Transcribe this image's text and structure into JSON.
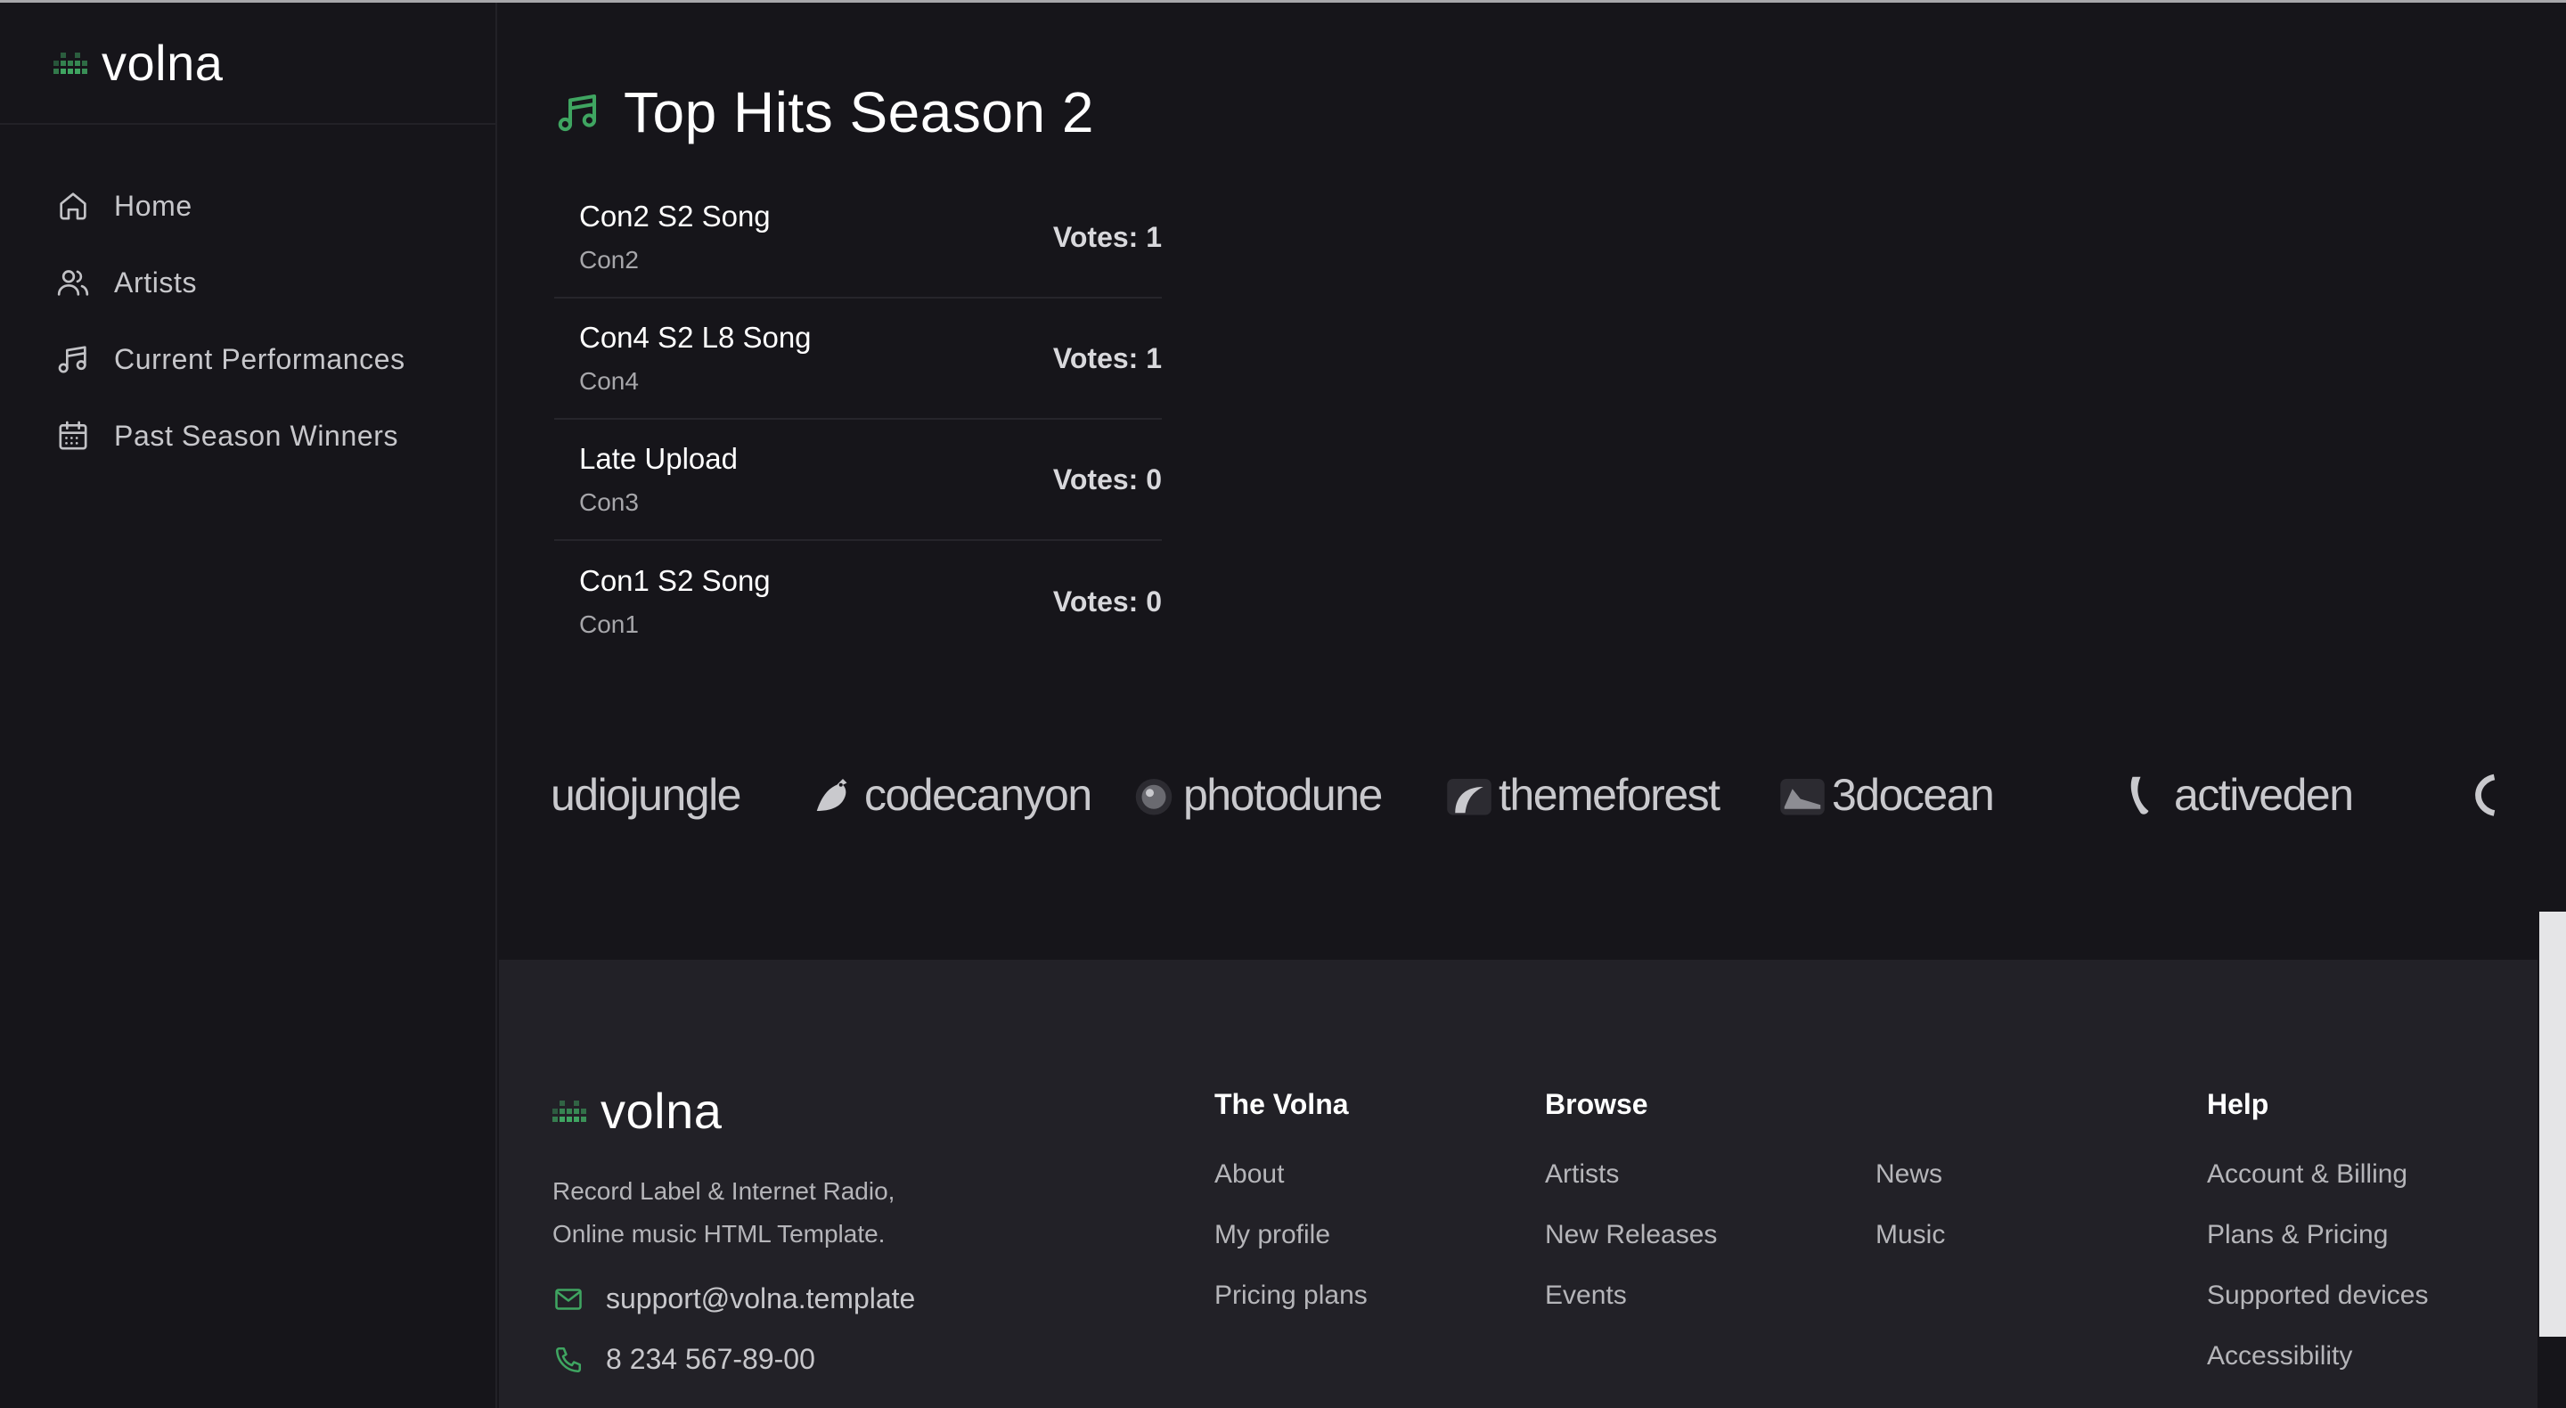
{
  "brand": {
    "name": "volna",
    "accent": "#3fa561"
  },
  "sidebar": {
    "items": [
      {
        "label": "Home",
        "icon": "home-icon"
      },
      {
        "label": "Artists",
        "icon": "users-icon"
      },
      {
        "label": "Current Performances",
        "icon": "music-note-icon"
      },
      {
        "label": "Past Season Winners",
        "icon": "calendar-icon"
      }
    ]
  },
  "main": {
    "title": "Top Hits Season 2",
    "tracks": [
      {
        "title": "Con2 S2 Song",
        "artist": "Con2",
        "votes": "Votes: 1"
      },
      {
        "title": "Con4 S2 L8 Song",
        "artist": "Con4",
        "votes": "Votes: 1"
      },
      {
        "title": "Late Upload",
        "artist": "Con3",
        "votes": "Votes: 0"
      },
      {
        "title": "Con1 S2 Song",
        "artist": "Con1",
        "votes": "Votes: 0"
      }
    ],
    "partners": [
      "udiojungle",
      "codecanyon",
      "photodune",
      "themeforest",
      "3docean",
      "activeden"
    ]
  },
  "footer": {
    "description_line1": "Record Label & Internet Radio,",
    "description_line2": "Online music HTML Template.",
    "email": "support@volna.template",
    "phone": "8 234 567-89-00",
    "col_volna": {
      "title": "The Volna",
      "links": [
        "About",
        "My profile",
        "Pricing plans"
      ]
    },
    "col_browse": {
      "title": "Browse",
      "links": [
        "Artists",
        "New Releases",
        "Events"
      ],
      "links2": [
        "News",
        "Music"
      ]
    },
    "col_help": {
      "title": "Help",
      "links": [
        "Account & Billing",
        "Plans & Pricing",
        "Supported devices",
        "Accessibility"
      ]
    }
  }
}
